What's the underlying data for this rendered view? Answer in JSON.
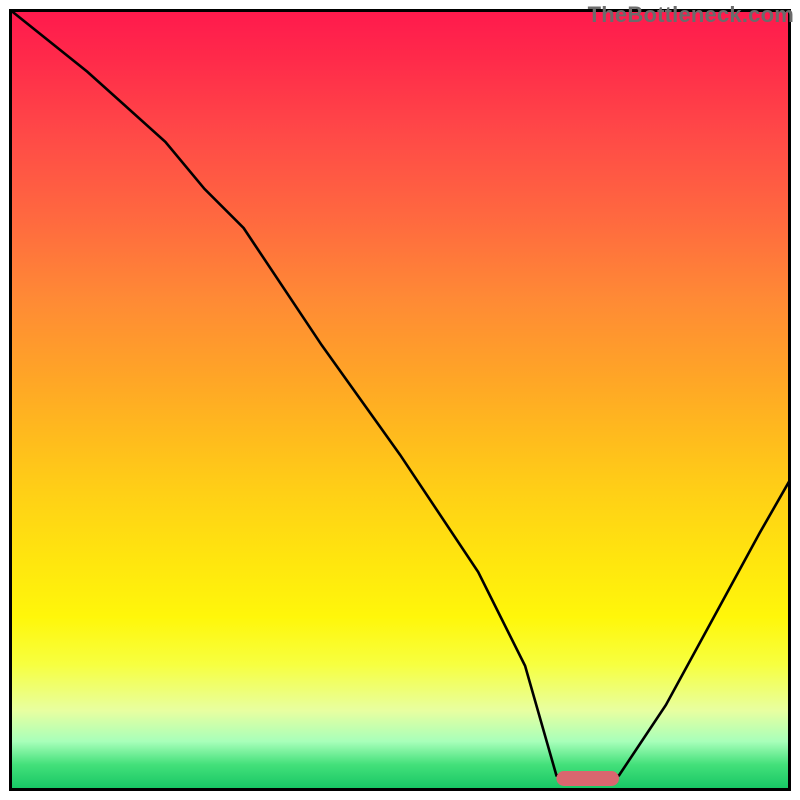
{
  "watermark": "TheBottleneck.com",
  "colors": {
    "frame_border": "#000000",
    "curve": "#000000",
    "marker_fill": "#d9666f",
    "gradient_top": "#ff1a4d",
    "gradient_bottom": "#18c765"
  },
  "chart_data": {
    "type": "line",
    "title": "",
    "xlabel": "",
    "ylabel": "",
    "xlim": [
      0,
      100
    ],
    "ylim": [
      0,
      100
    ],
    "grid": false,
    "legend": false,
    "annotations": [
      "TheBottleneck.com"
    ],
    "marker": {
      "x_start": 70,
      "x_end": 78,
      "y": 0
    },
    "series": [
      {
        "name": "curve",
        "x": [
          0,
          10,
          20,
          25,
          30,
          40,
          50,
          60,
          66,
          70,
          78,
          84,
          90,
          96,
          100
        ],
        "y": [
          100,
          92,
          83,
          77,
          72,
          57,
          43,
          28,
          16,
          2,
          2,
          11,
          22,
          33,
          40
        ]
      }
    ]
  }
}
